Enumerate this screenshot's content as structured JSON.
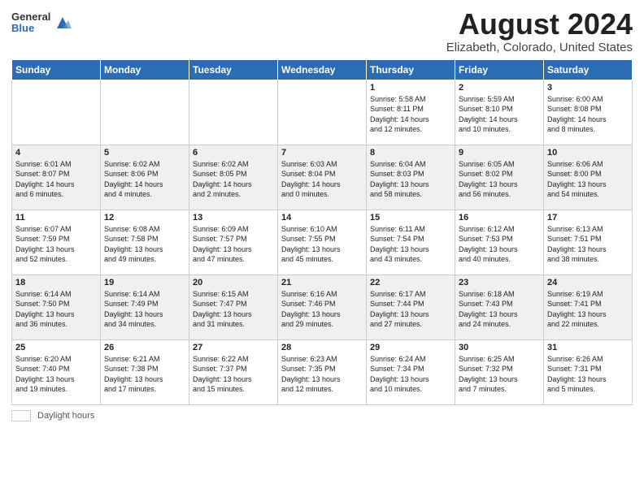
{
  "header": {
    "logo_general": "General",
    "logo_blue": "Blue",
    "title": "August 2024",
    "subtitle": "Elizabeth, Colorado, United States"
  },
  "days_of_week": [
    "Sunday",
    "Monday",
    "Tuesday",
    "Wednesday",
    "Thursday",
    "Friday",
    "Saturday"
  ],
  "weeks": [
    [
      {
        "day": "",
        "info": ""
      },
      {
        "day": "",
        "info": ""
      },
      {
        "day": "",
        "info": ""
      },
      {
        "day": "",
        "info": ""
      },
      {
        "day": "1",
        "info": "Sunrise: 5:58 AM\nSunset: 8:11 PM\nDaylight: 14 hours\nand 12 minutes."
      },
      {
        "day": "2",
        "info": "Sunrise: 5:59 AM\nSunset: 8:10 PM\nDaylight: 14 hours\nand 10 minutes."
      },
      {
        "day": "3",
        "info": "Sunrise: 6:00 AM\nSunset: 8:08 PM\nDaylight: 14 hours\nand 8 minutes."
      }
    ],
    [
      {
        "day": "4",
        "info": "Sunrise: 6:01 AM\nSunset: 8:07 PM\nDaylight: 14 hours\nand 6 minutes."
      },
      {
        "day": "5",
        "info": "Sunrise: 6:02 AM\nSunset: 8:06 PM\nDaylight: 14 hours\nand 4 minutes."
      },
      {
        "day": "6",
        "info": "Sunrise: 6:02 AM\nSunset: 8:05 PM\nDaylight: 14 hours\nand 2 minutes."
      },
      {
        "day": "7",
        "info": "Sunrise: 6:03 AM\nSunset: 8:04 PM\nDaylight: 14 hours\nand 0 minutes."
      },
      {
        "day": "8",
        "info": "Sunrise: 6:04 AM\nSunset: 8:03 PM\nDaylight: 13 hours\nand 58 minutes."
      },
      {
        "day": "9",
        "info": "Sunrise: 6:05 AM\nSunset: 8:02 PM\nDaylight: 13 hours\nand 56 minutes."
      },
      {
        "day": "10",
        "info": "Sunrise: 6:06 AM\nSunset: 8:00 PM\nDaylight: 13 hours\nand 54 minutes."
      }
    ],
    [
      {
        "day": "11",
        "info": "Sunrise: 6:07 AM\nSunset: 7:59 PM\nDaylight: 13 hours\nand 52 minutes."
      },
      {
        "day": "12",
        "info": "Sunrise: 6:08 AM\nSunset: 7:58 PM\nDaylight: 13 hours\nand 49 minutes."
      },
      {
        "day": "13",
        "info": "Sunrise: 6:09 AM\nSunset: 7:57 PM\nDaylight: 13 hours\nand 47 minutes."
      },
      {
        "day": "14",
        "info": "Sunrise: 6:10 AM\nSunset: 7:55 PM\nDaylight: 13 hours\nand 45 minutes."
      },
      {
        "day": "15",
        "info": "Sunrise: 6:11 AM\nSunset: 7:54 PM\nDaylight: 13 hours\nand 43 minutes."
      },
      {
        "day": "16",
        "info": "Sunrise: 6:12 AM\nSunset: 7:53 PM\nDaylight: 13 hours\nand 40 minutes."
      },
      {
        "day": "17",
        "info": "Sunrise: 6:13 AM\nSunset: 7:51 PM\nDaylight: 13 hours\nand 38 minutes."
      }
    ],
    [
      {
        "day": "18",
        "info": "Sunrise: 6:14 AM\nSunset: 7:50 PM\nDaylight: 13 hours\nand 36 minutes."
      },
      {
        "day": "19",
        "info": "Sunrise: 6:14 AM\nSunset: 7:49 PM\nDaylight: 13 hours\nand 34 minutes."
      },
      {
        "day": "20",
        "info": "Sunrise: 6:15 AM\nSunset: 7:47 PM\nDaylight: 13 hours\nand 31 minutes."
      },
      {
        "day": "21",
        "info": "Sunrise: 6:16 AM\nSunset: 7:46 PM\nDaylight: 13 hours\nand 29 minutes."
      },
      {
        "day": "22",
        "info": "Sunrise: 6:17 AM\nSunset: 7:44 PM\nDaylight: 13 hours\nand 27 minutes."
      },
      {
        "day": "23",
        "info": "Sunrise: 6:18 AM\nSunset: 7:43 PM\nDaylight: 13 hours\nand 24 minutes."
      },
      {
        "day": "24",
        "info": "Sunrise: 6:19 AM\nSunset: 7:41 PM\nDaylight: 13 hours\nand 22 minutes."
      }
    ],
    [
      {
        "day": "25",
        "info": "Sunrise: 6:20 AM\nSunset: 7:40 PM\nDaylight: 13 hours\nand 19 minutes."
      },
      {
        "day": "26",
        "info": "Sunrise: 6:21 AM\nSunset: 7:38 PM\nDaylight: 13 hours\nand 17 minutes."
      },
      {
        "day": "27",
        "info": "Sunrise: 6:22 AM\nSunset: 7:37 PM\nDaylight: 13 hours\nand 15 minutes."
      },
      {
        "day": "28",
        "info": "Sunrise: 6:23 AM\nSunset: 7:35 PM\nDaylight: 13 hours\nand 12 minutes."
      },
      {
        "day": "29",
        "info": "Sunrise: 6:24 AM\nSunset: 7:34 PM\nDaylight: 13 hours\nand 10 minutes."
      },
      {
        "day": "30",
        "info": "Sunrise: 6:25 AM\nSunset: 7:32 PM\nDaylight: 13 hours\nand 7 minutes."
      },
      {
        "day": "31",
        "info": "Sunrise: 6:26 AM\nSunset: 7:31 PM\nDaylight: 13 hours\nand 5 minutes."
      }
    ]
  ],
  "footer": {
    "label": "Daylight hours"
  }
}
